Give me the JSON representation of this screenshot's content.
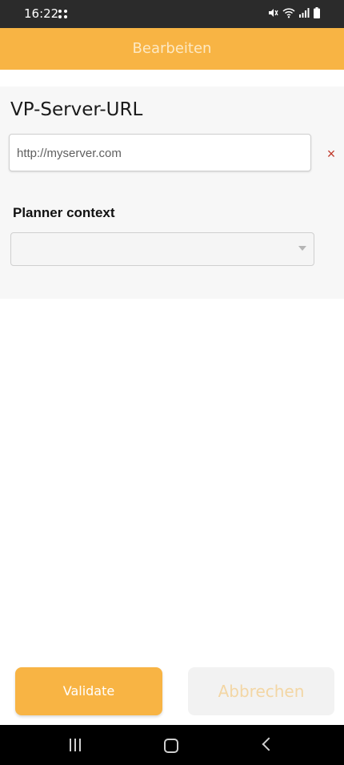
{
  "status_bar": {
    "time": "16:22"
  },
  "header": {
    "title": "Bearbeiten"
  },
  "form": {
    "url_label": "VP-Server-URL",
    "url_placeholder": "http://myserver.com",
    "clear_icon": "×",
    "context_label": "Planner context",
    "context_value": ""
  },
  "actions": {
    "validate_label": "Validate",
    "cancel_label": "Abbrechen"
  },
  "icons": [
    "mute-icon",
    "wifi-icon",
    "signal-icon",
    "battery-icon",
    "clear-icon",
    "dropdown-caret-icon"
  ],
  "colors": {
    "accent": "#f8b444",
    "status_bar": "#2b2b2b",
    "clear": "#c0392b"
  }
}
